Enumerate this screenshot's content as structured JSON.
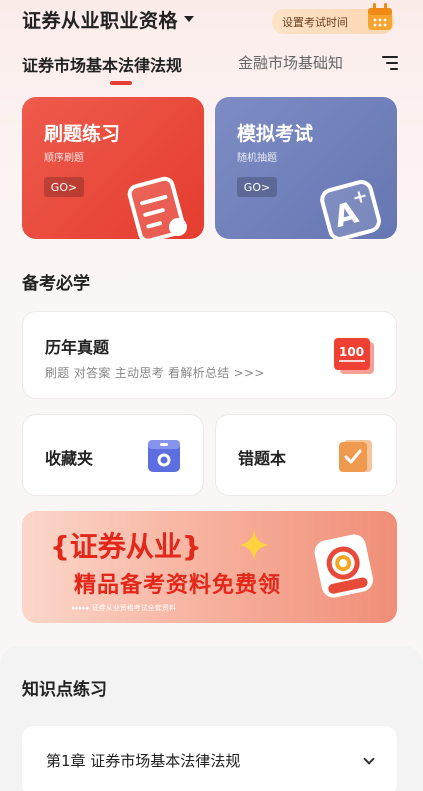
{
  "header": {
    "title": "证券从业职业资格",
    "exam_time_label": "设置考试时间"
  },
  "tabs": [
    {
      "label": "证券市场基本法律法规",
      "active": true
    },
    {
      "label": "金融市场基础知",
      "active": false
    }
  ],
  "cards": {
    "practice": {
      "title": "刷题练习",
      "subtitle": "顺序刷题",
      "go": "GO>"
    },
    "mock": {
      "title": "模拟考试",
      "subtitle": "随机抽题",
      "go": "GO>"
    }
  },
  "section_title": "备考必学",
  "history": {
    "title": "历年真题",
    "subtitle": "刷题  对答案  主动思考  看解析总结 >>>",
    "badge": "100"
  },
  "favorites": {
    "title": "收藏夹"
  },
  "wrong_book": {
    "title": "错题本"
  },
  "banner": {
    "line1": "{证券从业}",
    "line2": "精品备考资料免费领",
    "line3": "▸▸▸▸▸  证券从业资格考试全套资料"
  },
  "knowledge": {
    "title": "知识点练习",
    "chapters": [
      {
        "label": "第1章  证券市场基本法律法规"
      }
    ]
  },
  "colors": {
    "accent": "#e83b33",
    "practice_card": "#e84c3e",
    "mock_card": "#7282bc"
  }
}
